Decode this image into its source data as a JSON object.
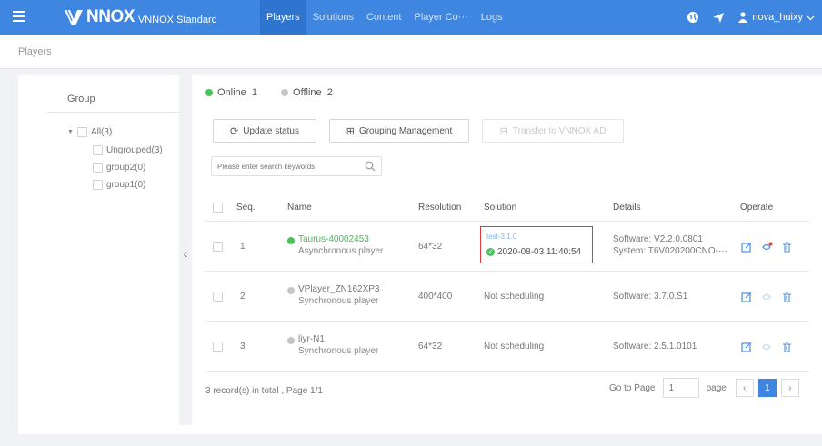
{
  "header": {
    "logo_text": "NNOX",
    "logo_sub": "VNNOX Standard",
    "nav": [
      "Players",
      "Solutions",
      "Content",
      "Player Co···",
      "Logs"
    ],
    "active_nav": "Players",
    "user_name": "nova_huixy",
    "icons": [
      "menu-icon",
      "globe-icon",
      "send-icon",
      "person-icon",
      "chevron-down-icon"
    ]
  },
  "breadcrumb": {
    "label": "Players"
  },
  "group": {
    "title": "Group",
    "tree": [
      {
        "label": "All(3)",
        "level": 0,
        "expanded": true
      },
      {
        "label": "Ungrouped(3)",
        "level": 1
      },
      {
        "label": "group2(0)",
        "level": 1
      },
      {
        "label": "group1(0)",
        "level": 1
      }
    ]
  },
  "status": {
    "online_label": "Online",
    "online_count": "1",
    "offline_label": "Offline",
    "offline_count": "2"
  },
  "toolbar": {
    "update_status": "Update status",
    "grouping_management": "Grouping Management",
    "transfer": "Transfer to VNNOX AD"
  },
  "search": {
    "placeholder": "Please enter search keywords"
  },
  "table": {
    "columns": [
      "Seq.",
      "Name",
      "Resolution",
      "Solution",
      "Details",
      "Operate"
    ],
    "rows": [
      {
        "seq": "1",
        "name": "Taurus-40002453",
        "type": "Asynchronous player",
        "online": true,
        "resolution": "64*32",
        "solution_link": "test-3.1.0",
        "solution_time": "2020-08-03 11:40:54",
        "details_line1": "Software: V2.2.0.0801",
        "details_line2": "System: T6V020200CNO-···"
      },
      {
        "seq": "2",
        "name": "VPlayer_ZN162XP3",
        "type": "Synchronous player",
        "online": false,
        "resolution": "400*400",
        "solution": "Not scheduling",
        "details_line1": "Software: 3.7.0.S1"
      },
      {
        "seq": "3",
        "name": "liyr-N1",
        "type": "Synchronous player",
        "online": false,
        "resolution": "64*32",
        "solution": "Not scheduling",
        "details_line1": "Software: 2.5.1.0101"
      }
    ]
  },
  "footer": {
    "summary": "3 record(s) in total , Page 1/1",
    "goto_label": "Go to Page",
    "goto_value": "1",
    "page_label": "page",
    "current_page": "1"
  },
  "colors": {
    "brand": "#3f86e0",
    "online": "#4cc25d",
    "highlight": "#e23a3a"
  }
}
